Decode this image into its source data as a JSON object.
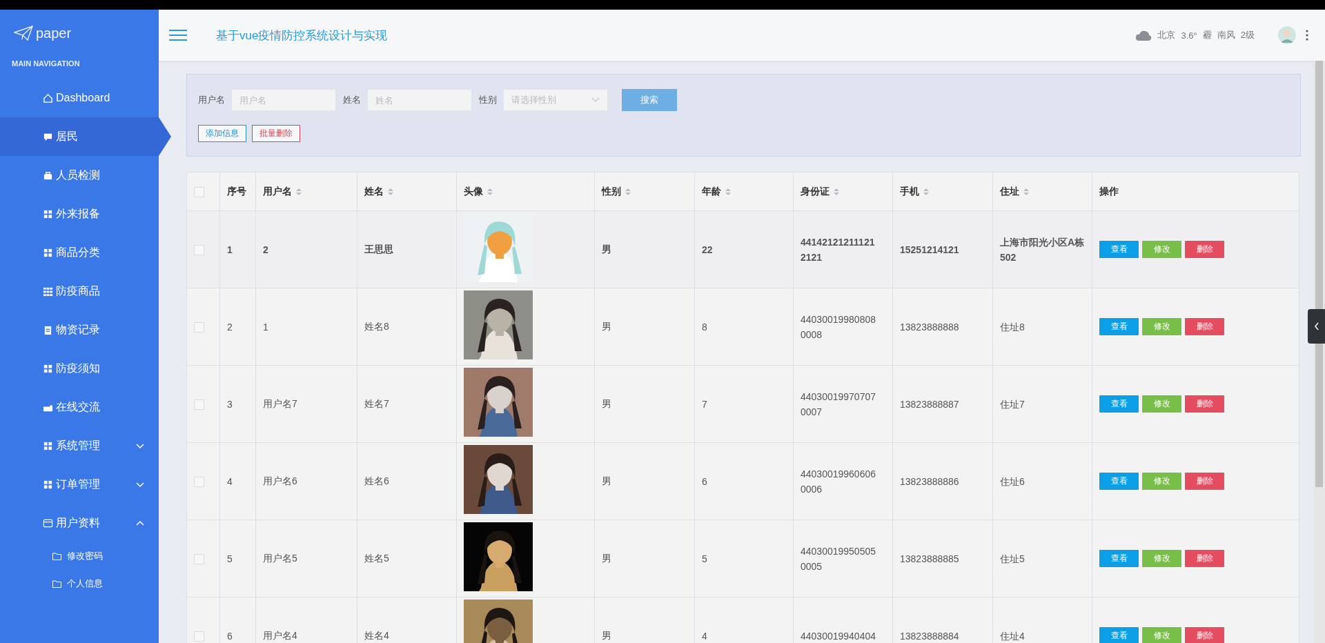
{
  "sidebar": {
    "logo": "paper",
    "section_title": "MAIN NAVIGATION",
    "items": [
      {
        "label": "Dashboard",
        "selected": false
      },
      {
        "label": "居民",
        "selected": true
      },
      {
        "label": "人员检测",
        "selected": false
      },
      {
        "label": "外来报备",
        "selected": false
      },
      {
        "label": "商品分类",
        "selected": false
      },
      {
        "label": "防疫商品",
        "selected": false
      },
      {
        "label": "物资记录",
        "selected": false
      },
      {
        "label": "防疫须知",
        "selected": false
      },
      {
        "label": "在线交流",
        "selected": false
      },
      {
        "label": "系统管理",
        "selected": false,
        "expanded": false
      },
      {
        "label": "订单管理",
        "selected": false,
        "expanded": false
      },
      {
        "label": "用户资料",
        "selected": false,
        "expanded": true,
        "children": [
          {
            "label": "修改密码",
            "selected": false
          },
          {
            "label": "个人信息",
            "selected": false
          }
        ]
      }
    ]
  },
  "header": {
    "title": "基于vue疫情防控系统设计与实现",
    "weather": {
      "city": "北京",
      "temperature": "3.6°",
      "condition": "霾",
      "wind": "南风",
      "wind_level": "2级"
    }
  },
  "search": {
    "fields": [
      {
        "label": "用户名",
        "placeholder": "用户名",
        "kind": "text"
      },
      {
        "label": "姓名",
        "placeholder": "姓名",
        "kind": "text"
      },
      {
        "label": "性别",
        "placeholder": "请选择性别",
        "kind": "select"
      }
    ],
    "search_button": "搜索",
    "add_button": "添加信息",
    "batch_delete_button": "批量删除"
  },
  "table": {
    "select_all_checked": false,
    "columns": [
      {
        "label": "序号",
        "sortable": false
      },
      {
        "label": "用户名",
        "sortable": true
      },
      {
        "label": "姓名",
        "sortable": true
      },
      {
        "label": "头像",
        "sortable": true
      },
      {
        "label": "性别",
        "sortable": true
      },
      {
        "label": "年龄",
        "sortable": true
      },
      {
        "label": "身份证",
        "sortable": true
      },
      {
        "label": "手机",
        "sortable": true
      },
      {
        "label": "住址",
        "sortable": true
      },
      {
        "label": "操作",
        "sortable": false
      }
    ],
    "rows": [
      {
        "selected": true,
        "checked": false,
        "index": "1",
        "username": "2",
        "name": "王思思",
        "gender": "男",
        "age": "22",
        "id_card": "441421212111212121",
        "phone": "15251214121",
        "address": "上海市阳光小区A栋502",
        "actions": [
          {
            "label": "查看",
            "kind": "view"
          },
          {
            "label": "修改",
            "kind": "edit"
          },
          {
            "label": "删除",
            "kind": "delete"
          }
        ]
      },
      {
        "selected": false,
        "checked": false,
        "index": "2",
        "username": "1",
        "name": "姓名8",
        "gender": "男",
        "age": "8",
        "id_card": "440300199808080008",
        "phone": "13823888888",
        "address": "住址8",
        "actions": [
          {
            "label": "查看",
            "kind": "view"
          },
          {
            "label": "修改",
            "kind": "edit"
          },
          {
            "label": "删除",
            "kind": "delete"
          }
        ]
      },
      {
        "selected": false,
        "checked": false,
        "index": "3",
        "username": "用户名7",
        "name": "姓名7",
        "gender": "男",
        "age": "7",
        "id_card": "440300199707070007",
        "phone": "13823888887",
        "address": "住址7",
        "actions": [
          {
            "label": "查看",
            "kind": "view"
          },
          {
            "label": "修改",
            "kind": "edit"
          },
          {
            "label": "删除",
            "kind": "delete"
          }
        ]
      },
      {
        "selected": false,
        "checked": false,
        "index": "4",
        "username": "用户名6",
        "name": "姓名6",
        "gender": "男",
        "age": "6",
        "id_card": "440300199606060006",
        "phone": "13823888886",
        "address": "住址6",
        "actions": [
          {
            "label": "查看",
            "kind": "view"
          },
          {
            "label": "修改",
            "kind": "edit"
          },
          {
            "label": "删除",
            "kind": "delete"
          }
        ]
      },
      {
        "selected": false,
        "checked": false,
        "index": "5",
        "username": "用户名5",
        "name": "姓名5",
        "gender": "男",
        "age": "5",
        "id_card": "440300199505050005",
        "phone": "13823888885",
        "address": "住址5",
        "actions": [
          {
            "label": "查看",
            "kind": "view"
          },
          {
            "label": "修改",
            "kind": "edit"
          },
          {
            "label": "删除",
            "kind": "delete"
          }
        ]
      },
      {
        "selected": false,
        "checked": false,
        "index": "6",
        "username": "用户名4",
        "name": "姓名4",
        "gender": "男",
        "age": "4",
        "id_card": "44030019940404",
        "phone": "13823888884",
        "address": "住址4",
        "actions": [
          {
            "label": "查看",
            "kind": "view"
          },
          {
            "label": "修改",
            "kind": "edit"
          },
          {
            "label": "删除",
            "kind": "delete"
          }
        ]
      }
    ]
  }
}
